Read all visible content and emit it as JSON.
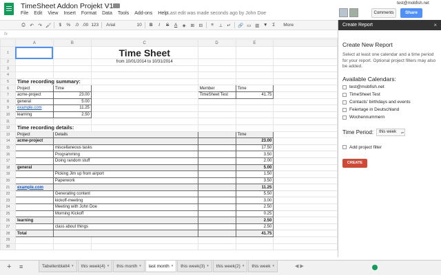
{
  "header": {
    "title": "TimeSheet Addon Projekt V1",
    "menus": [
      "File",
      "Edit",
      "View",
      "Insert",
      "Format",
      "Data",
      "Tools",
      "Add-ons",
      "Help"
    ],
    "last_edit": "Last edit was made seconds ago by John Doe",
    "user_email": "test@mobfish.net",
    "comments_label": "Comments",
    "share_label": "Share"
  },
  "toolbar": {
    "percent": "%",
    "dollar": "$",
    "decimals_less": ".0",
    "decimals_more": ".00",
    "number_format": "123",
    "font": "Arial",
    "font_size": "10",
    "bold": "B",
    "italic": "I",
    "strike": "S",
    "text_color": "A",
    "more": "More"
  },
  "formula": {
    "fx": "fx"
  },
  "grid": {
    "columns": [
      "A",
      "B",
      "C",
      "D",
      "E"
    ],
    "title": "Time Sheet",
    "subtitle": "from 10/01/2014 to 10/31/2014",
    "summary_heading": "Time recording summary:",
    "summary_project_col": "Project",
    "summary_time_col": "Time",
    "summary": [
      {
        "project": "acme-project",
        "time": "23.00",
        "link": false
      },
      {
        "project": "general",
        "time": "5.00",
        "link": false
      },
      {
        "project": "example.com",
        "time": "11.25",
        "link": true
      },
      {
        "project": "learning",
        "time": "2.50",
        "link": false
      }
    ],
    "member_col": "Member",
    "member_time_col": "Time",
    "member": {
      "name": "TimeSheet Test",
      "time": "41.75"
    },
    "details_heading": "Time recording details:",
    "details_project_col": "Project",
    "details_details_col": "Details",
    "details_time_col": "Time",
    "total_label": "Total",
    "total_value": "41.75",
    "details": [
      {
        "row": 14,
        "project": "acme-project",
        "details": "",
        "time": "23.00",
        "group": true,
        "link": false
      },
      {
        "row": 15,
        "project": "",
        "details": "miscellaneous tasks",
        "time": "17.50",
        "group": false,
        "link": false
      },
      {
        "row": 16,
        "project": "",
        "details": "Programming",
        "time": "3.50",
        "group": false,
        "link": false
      },
      {
        "row": 17,
        "project": "",
        "details": "Doing random stuff",
        "time": "2.00",
        "group": false,
        "link": false
      },
      {
        "row": 18,
        "project": "general",
        "details": "",
        "time": "5.00",
        "group": true,
        "link": false
      },
      {
        "row": 19,
        "project": "",
        "details": "Picking Jim up from airport",
        "time": "1.50",
        "group": false,
        "link": false
      },
      {
        "row": 20,
        "project": "",
        "details": "Paperwork",
        "time": "3.50",
        "group": false,
        "link": false
      },
      {
        "row": 21,
        "project": "example.com",
        "details": "",
        "time": "11.25",
        "group": true,
        "link": true
      },
      {
        "row": 22,
        "project": "",
        "details": "Generating content",
        "time": "5.50",
        "group": false,
        "link": false
      },
      {
        "row": 23,
        "project": "",
        "details": "kickoff-meeting",
        "time": "3.00",
        "group": false,
        "link": false
      },
      {
        "row": 24,
        "project": "",
        "details": "Meeting with John Doe",
        "time": "2.50",
        "group": false,
        "link": false
      },
      {
        "row": 25,
        "project": "",
        "details": "Morning Kickoff",
        "time": "0.25",
        "group": false,
        "link": false
      },
      {
        "row": 26,
        "project": "learning",
        "details": "",
        "time": "2.50",
        "group": true,
        "link": false
      },
      {
        "row": 27,
        "project": "",
        "details": "class about things",
        "time": "2.50",
        "group": false,
        "link": false
      }
    ]
  },
  "sidebar": {
    "header": "Create Report",
    "close": "×",
    "title": "Create New Report",
    "description": "Select at least one calendar and a time period for your report. Optional project filters may also be added.",
    "calendars_heading": "Available Calendars:",
    "calendars": [
      "test@mobfish.net",
      "TimeSheet Test",
      "Contacts' birthdays and events",
      "Feiertage in Deutschland",
      "Wochennummern"
    ],
    "period_label": "Time Period:",
    "period_value": "this week",
    "filter_label": "Add project filter",
    "create_label": "CREATE"
  },
  "bottom": {
    "add_sheet": "+",
    "list_sheets": "≡",
    "tabs": [
      {
        "label": "Tabellenblatt4",
        "active": false
      },
      {
        "label": "this week(4)",
        "active": false
      },
      {
        "label": "this month",
        "active": false
      },
      {
        "label": "last month",
        "active": true
      },
      {
        "label": "this week(3)",
        "active": false
      },
      {
        "label": "this week(2)",
        "active": false
      },
      {
        "label": "this week",
        "active": false
      }
    ],
    "arrows": "◀ ▶"
  },
  "colors": {
    "share": "#4d90fe",
    "create": "#d14836",
    "sheets_green": "#0f9d58",
    "sidebar_header": "#333333"
  }
}
